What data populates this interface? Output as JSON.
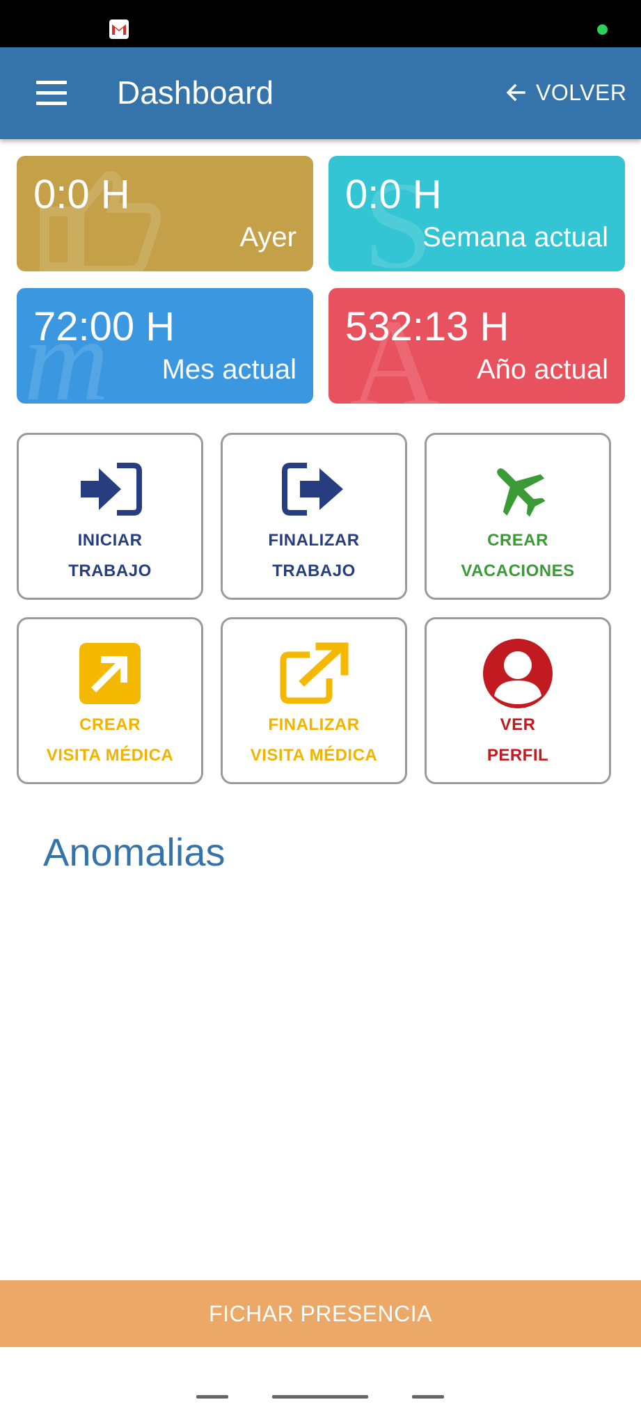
{
  "status_bar": {
    "left_icon": "gmail-icon",
    "right_indicator": "green-dot",
    "indicator_color": "#2bd15a"
  },
  "app_bar": {
    "menu_icon": "hamburger-menu-icon",
    "title": "Dashboard",
    "back_icon": "arrow-left-icon",
    "back_label": "VOLVER",
    "background": "#3574ab"
  },
  "stats": [
    {
      "value": "0:0 H",
      "label": "Ayer",
      "color": "#c4a149",
      "bg_icon": "thumbs-up-icon"
    },
    {
      "value": "0:0 H",
      "label": "Semana actual",
      "color": "#33c5d3",
      "bg_icon": "letter-s-icon"
    },
    {
      "value": "72:00 H",
      "label": "Mes actual",
      "color": "#3b98e0",
      "bg_icon": "letter-m-icon"
    },
    {
      "value": "532:13 H",
      "label": "Año actual",
      "color": "#e8525f",
      "bg_icon": "letter-a-icon"
    }
  ],
  "actions": [
    {
      "line1": "INICIAR",
      "line2": "TRABAJO",
      "icon": "sign-in-icon",
      "color": "#263d80"
    },
    {
      "line1": "FINALIZAR",
      "line2": "TRABAJO",
      "icon": "sign-out-icon",
      "color": "#263d80"
    },
    {
      "line1": "CREAR",
      "line2": "VACACIONES",
      "icon": "airplane-icon",
      "color": "#3a9a36"
    },
    {
      "line1": "CREAR",
      "line2": "VISITA MÉDICA",
      "icon": "external-arrow-square-icon",
      "color": "#f0b400"
    },
    {
      "line1": "FINALIZAR",
      "line2": "VISITA MÉDICA",
      "icon": "external-link-icon",
      "color": "#f0b400"
    },
    {
      "line1": "VER",
      "line2": "PERFIL",
      "icon": "user-circle-icon",
      "color": "#c21a21"
    }
  ],
  "anomalias": {
    "title": "Anomalias"
  },
  "footer": {
    "button_label": "FICHAR PRESENCIA",
    "color": "#eca866"
  }
}
